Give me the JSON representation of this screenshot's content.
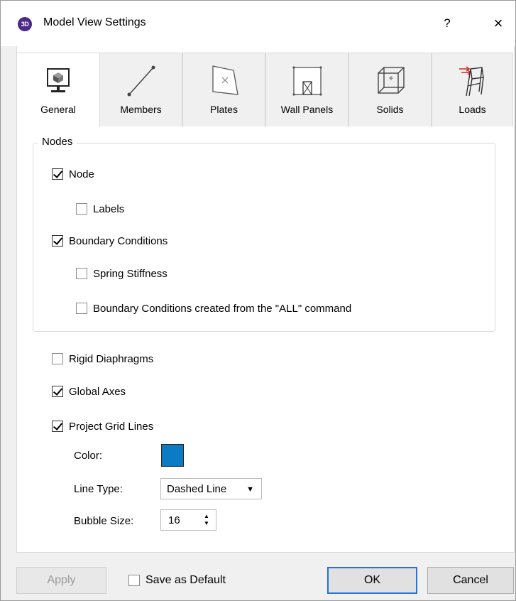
{
  "window": {
    "icon_text": "3D",
    "title": "Model View Settings",
    "help": "?",
    "close": "×"
  },
  "tabs": [
    {
      "label": "General",
      "active": true,
      "icon": "monitor-cube-icon"
    },
    {
      "label": "Members",
      "active": false,
      "icon": "member-line-icon"
    },
    {
      "label": "Plates",
      "active": false,
      "icon": "plate-icon"
    },
    {
      "label": "Wall Panels",
      "active": false,
      "icon": "wall-panel-icon"
    },
    {
      "label": "Solids",
      "active": false,
      "icon": "solid-cube-icon"
    },
    {
      "label": "Loads",
      "active": false,
      "icon": "loads-frame-icon"
    }
  ],
  "nodes_group": {
    "title": "Nodes",
    "items": [
      {
        "label": "Node",
        "checked": true
      },
      {
        "label": "Labels",
        "checked": false
      },
      {
        "label": "Boundary Conditions",
        "checked": true
      },
      {
        "label": "Spring Stiffness",
        "checked": false
      },
      {
        "label": "Boundary Conditions created from the \"ALL\" command",
        "checked": false
      }
    ]
  },
  "options": [
    {
      "label": "Rigid Diaphragms",
      "checked": false
    },
    {
      "label": "Global Axes",
      "checked": true
    },
    {
      "label": "Project Grid Lines",
      "checked": true
    }
  ],
  "grid": {
    "color_label": "Color:",
    "color_value": "#0a7bc4",
    "line_type_label": "Line Type:",
    "line_type_value": "Dashed Line",
    "bubble_size_label": "Bubble Size:",
    "bubble_size_value": "16"
  },
  "footer": {
    "apply": "Apply",
    "save_default": "Save as Default",
    "save_default_checked": false,
    "ok": "OK",
    "cancel": "Cancel"
  }
}
